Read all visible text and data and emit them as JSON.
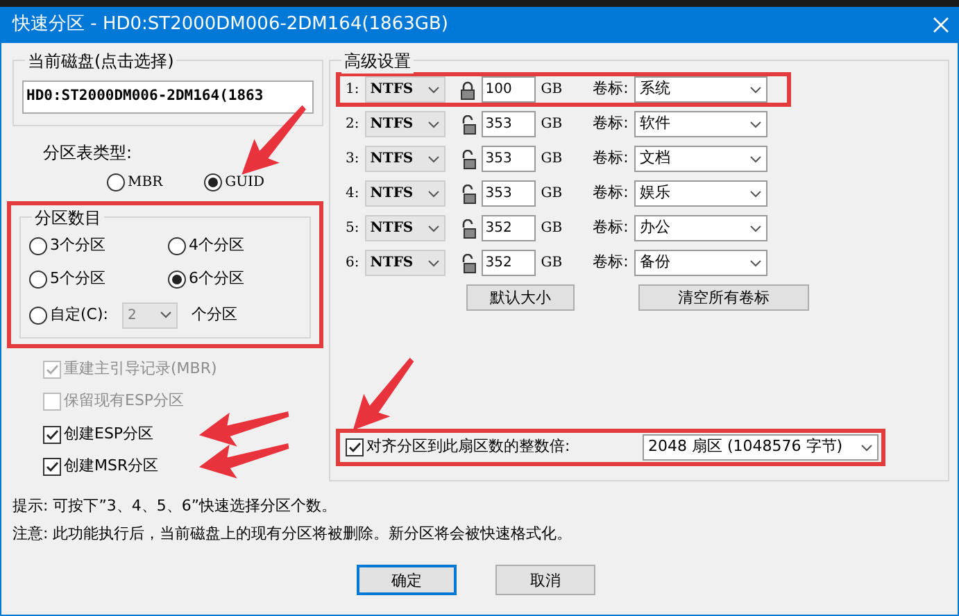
{
  "window": {
    "title": "快速分区 - HD0:ST2000DM006-2DM164(1863GB)"
  },
  "current_disk": {
    "label": "当前磁盘(点击选择)",
    "value": "HD0:ST2000DM006-2DM164(1863"
  },
  "partition_table": {
    "label": "分区表类型:",
    "options": [
      {
        "label": "MBR",
        "selected": false,
        "arrow": false
      },
      {
        "label": "GUID",
        "selected": true,
        "arrow": true
      }
    ]
  },
  "partition_count": {
    "label": "分区数目",
    "highlighted": true,
    "options": [
      {
        "kind": "radio",
        "label": "3个分区",
        "selected": false
      },
      {
        "kind": "radio",
        "label": "4个分区",
        "selected": false
      },
      {
        "kind": "radio",
        "label": "5个分区",
        "selected": false
      },
      {
        "kind": "radio",
        "label": "6个分区",
        "selected": true
      },
      {
        "kind": "custom",
        "label": "自定(C):",
        "selected": false,
        "value": "2",
        "suffix": "个分区"
      }
    ]
  },
  "options": [
    {
      "label": "重建主引导记录(MBR)",
      "checked": true,
      "disabled": true,
      "arrow": false
    },
    {
      "label": "保留现有ESP分区",
      "checked": false,
      "disabled": true,
      "arrow": false
    },
    {
      "label": "创建ESP分区",
      "checked": true,
      "disabled": false,
      "arrow": true
    },
    {
      "label": "创建MSR分区",
      "checked": true,
      "disabled": false,
      "arrow": true
    }
  ],
  "advanced": {
    "label": "高级设置",
    "rows": [
      {
        "index": "1:",
        "fs": "NTFS",
        "locked": true,
        "size": "100",
        "unit": "GB",
        "volume_label": "卷标:",
        "volume": "系统",
        "highlighted": true
      },
      {
        "index": "2:",
        "fs": "NTFS",
        "locked": false,
        "size": "353",
        "unit": "GB",
        "volume_label": "卷标:",
        "volume": "软件",
        "highlighted": false
      },
      {
        "index": "3:",
        "fs": "NTFS",
        "locked": false,
        "size": "353",
        "unit": "GB",
        "volume_label": "卷标:",
        "volume": "文档",
        "highlighted": false
      },
      {
        "index": "4:",
        "fs": "NTFS",
        "locked": false,
        "size": "353",
        "unit": "GB",
        "volume_label": "卷标:",
        "volume": "娱乐",
        "highlighted": false
      },
      {
        "index": "5:",
        "fs": "NTFS",
        "locked": false,
        "size": "352",
        "unit": "GB",
        "volume_label": "卷标:",
        "volume": "办公",
        "highlighted": false
      },
      {
        "index": "6:",
        "fs": "NTFS",
        "locked": false,
        "size": "352",
        "unit": "GB",
        "volume_label": "卷标:",
        "volume": "备份",
        "highlighted": false
      }
    ],
    "buttons": [
      "默认大小",
      "清空所有卷标"
    ],
    "align": {
      "label": "对齐分区到此扇区数的整数倍:",
      "checked": true,
      "value": "2048 扇区 (1048576 字节)",
      "highlighted": true,
      "arrow": true
    }
  },
  "notes": [
    "提示: 可按下”3、4、5、6”快速选择分区个数。",
    "注意: 此功能执行后，当前磁盘上的现有分区将被删除。新分区将会被快速格式化。"
  ],
  "buttons": [
    {
      "label": "确定",
      "default": true
    },
    {
      "label": "取消",
      "default": false
    }
  ]
}
